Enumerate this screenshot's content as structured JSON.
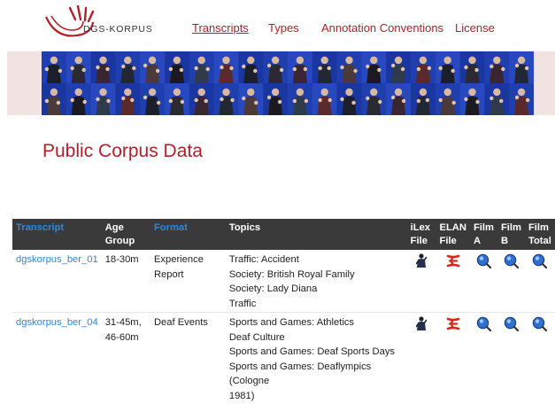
{
  "header": {
    "logo_text": "DGS-KORPUS",
    "nav": [
      {
        "label": "Transcripts",
        "active": true
      },
      {
        "label": "Types",
        "active": false
      },
      {
        "label": "Annotation Conventions",
        "active": false
      },
      {
        "label": "License",
        "active": false
      }
    ]
  },
  "page": {
    "title": "Public Corpus Data"
  },
  "table": {
    "headers": {
      "transcript": "Transcript",
      "age_line1": "Age",
      "age_line2": "Group",
      "format": "Format",
      "topics": "Topics",
      "ilex_line1": "iLex",
      "ilex_line2": "File",
      "elan_line1": "ELAN",
      "elan_line2": "File",
      "film_a_line1": "Film",
      "film_a_line2": "A",
      "film_b_line1": "Film",
      "film_b_line2": "B",
      "film_total_line1": "Film",
      "film_total_line2": "Total"
    },
    "rows": [
      {
        "transcript": "dgskorpus_ber_01",
        "age_line1": "18-30m",
        "age_line2": "",
        "format_line1": "Experience",
        "format_line2": "Report",
        "topics": [
          "Traffic: Accident",
          "Society: British Royal Family",
          "Society: Lady Diana",
          "Traffic"
        ]
      },
      {
        "transcript": "dgskorpus_ber_04",
        "age_line1": "31-45m,",
        "age_line2": "46-60m",
        "format_line1": "Deaf Events",
        "format_line2": "",
        "topics": [
          "Sports and Games: Athletics",
          "Deaf Culture",
          "Sports and Games: Deaf Sports Days",
          "Sports and Games: Deaflympics (Cologne",
          "1981)"
        ]
      }
    ]
  },
  "icons": {
    "ilex": "person-figure-icon",
    "elan": "elan-logo-icon",
    "film": "magnifier-play-icon"
  },
  "colors": {
    "brand_red": "#b3202a",
    "link_blue": "#2e86d9",
    "table_header_bg": "#3a3a3a",
    "banner_bg": "#f1e3e1",
    "elan_red": "#e0261b",
    "film_blue": "#2f6fd0"
  }
}
